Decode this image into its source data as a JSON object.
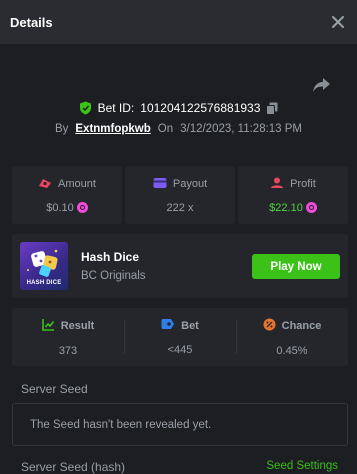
{
  "header": {
    "title": "Details"
  },
  "bet": {
    "id_label": "Bet ID:",
    "id": "101204122576881933",
    "by_label": "By",
    "user": "Extnmfopkwb",
    "on_label": "On",
    "datetime": "3/12/2023, 11:28:13 PM"
  },
  "stats": {
    "amount": {
      "label": "Amount",
      "value": "$0.10"
    },
    "payout": {
      "label": "Payout",
      "value": "222 x"
    },
    "profit": {
      "label": "Profit",
      "value": "$22.10"
    }
  },
  "game": {
    "name": "Hash Dice",
    "provider": "BC Originals",
    "thumb_label": "HASH DICE",
    "play_label": "Play Now"
  },
  "result": {
    "result": {
      "label": "Result",
      "value": "373"
    },
    "bet": {
      "label": "Bet",
      "value": "<445"
    },
    "chance": {
      "label": "Chance",
      "value": "0.45%"
    }
  },
  "server_seed": {
    "title": "Server Seed",
    "message": "The Seed hasn't been revealed yet."
  },
  "server_seed_hash": {
    "title": "Server Seed (hash)",
    "settings_label": "Seed Settings"
  },
  "colors": {
    "accent_green": "#3bc117",
    "profit_green": "#4fd13f",
    "amount_icon": "#e8475f",
    "payout_icon": "#7b5cf0",
    "profit_icon": "#e8475f",
    "coin": "#f04bd6",
    "bet_icon": "#2f7fe6",
    "chance_icon": "#e8732b"
  }
}
